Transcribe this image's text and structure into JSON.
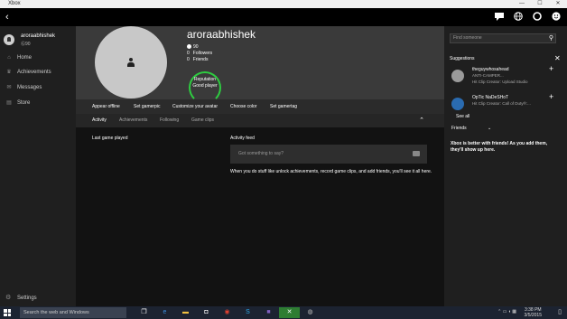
{
  "window": {
    "title": "Xbox",
    "minimize": "—",
    "maximize": "☐",
    "close": "✕"
  },
  "topbar": {
    "back": "‹",
    "icons": [
      "chat-icon",
      "globe-icon",
      "notifications-icon",
      "smiley-icon"
    ]
  },
  "sidebar": {
    "user": {
      "name": "aroraabhishek",
      "gamerscore": "90"
    },
    "items": [
      {
        "label": "Home",
        "icon": "home-icon"
      },
      {
        "label": "Achievements",
        "icon": "trophy-icon"
      },
      {
        "label": "Messages",
        "icon": "messages-icon"
      },
      {
        "label": "Store",
        "icon": "store-icon"
      }
    ],
    "settings": "Settings"
  },
  "profile": {
    "gamertag": "aroraabhishek",
    "gamerscore": "90",
    "followers_count": "0",
    "followers_label": "Followers",
    "friends_count": "0",
    "friends_label": "Friends",
    "reputation_label": "Reputation",
    "reputation_value": "Good player"
  },
  "actions": [
    "Appear offline",
    "Set gamerpic",
    "Customize your avatar",
    "Choose color",
    "Set gamertag"
  ],
  "tabs": [
    "Activity",
    "Achievements",
    "Following",
    "Game clips"
  ],
  "activity": {
    "last_game_played": "Last game played",
    "activity_feed": "Activity feed",
    "post_placeholder": "Got something to say?",
    "note": "When you do stuff like unlock achievements, record game clips, and add friends, you'll see it all here."
  },
  "right_panel": {
    "search_placeholder": "Find someone",
    "suggestions_title": "Suggestions",
    "suggestions": [
      {
        "name": "theguywhosahead",
        "line1": "ANTI-CAMPER...",
        "line2": "Hit Clip Creator: Upload Studio"
      },
      {
        "name": "OpTic NaDeSHoT",
        "line1": "Hit Clip Creator: Call of Duty®:...",
        "line2": ""
      }
    ],
    "see_all": "See all",
    "friends_dropdown": "Friends",
    "friends_message": "Xbox is better with friends! As you add them, they'll show up here."
  },
  "taskbar": {
    "search_placeholder": "Search the web and Windows",
    "time": "3:38 PM",
    "date": "3/5/2015"
  }
}
